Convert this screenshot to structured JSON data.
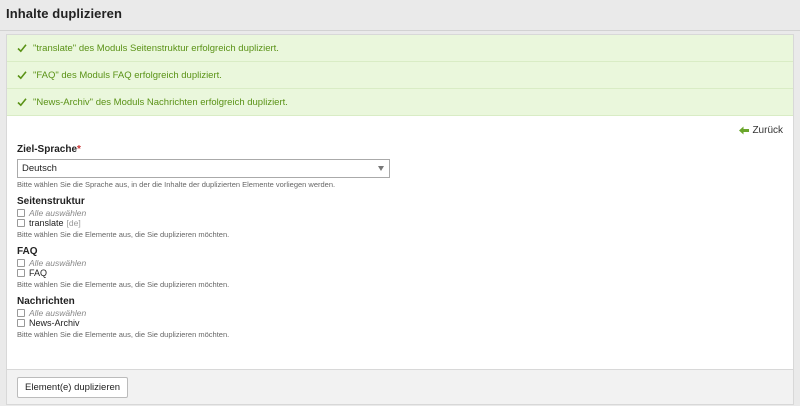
{
  "header": {
    "title": "Inhalte duplizieren"
  },
  "messages": [
    "\"translate\" des Moduls Seitenstruktur erfolgreich dupliziert.",
    "\"FAQ\" des Moduls FAQ erfolgreich dupliziert.",
    "\"News-Archiv\" des Moduls Nachrichten erfolgreich dupliziert."
  ],
  "back": {
    "label": "Zurück"
  },
  "target_language": {
    "label": "Ziel-Sprache",
    "required_mark": "*",
    "selected": "Deutsch",
    "help": "Bitte wählen Sie die Sprache aus, in der die Inhalte der duplizierten Elemente vorliegen werden."
  },
  "groups": [
    {
      "label": "Seitenstruktur",
      "select_all": "Alle auswählen",
      "item": "translate",
      "lang": "[de]",
      "help": "Bitte wählen Sie die Elemente aus, die Sie duplizieren möchten."
    },
    {
      "label": "FAQ",
      "select_all": "Alle auswählen",
      "item": "FAQ",
      "lang": "",
      "help": "Bitte wählen Sie die Elemente aus, die Sie duplizieren möchten."
    },
    {
      "label": "Nachrichten",
      "select_all": "Alle auswählen",
      "item": "News-Archiv",
      "lang": "",
      "help": "Bitte wählen Sie die Elemente aus, die Sie duplizieren möchten."
    }
  ],
  "footer": {
    "submit_label": "Element(e) duplizieren"
  },
  "colors": {
    "success_bg": "#eaf7dc",
    "success_text": "#5a9216",
    "back_arrow": "#6aa62a",
    "required": "#cc3333"
  }
}
